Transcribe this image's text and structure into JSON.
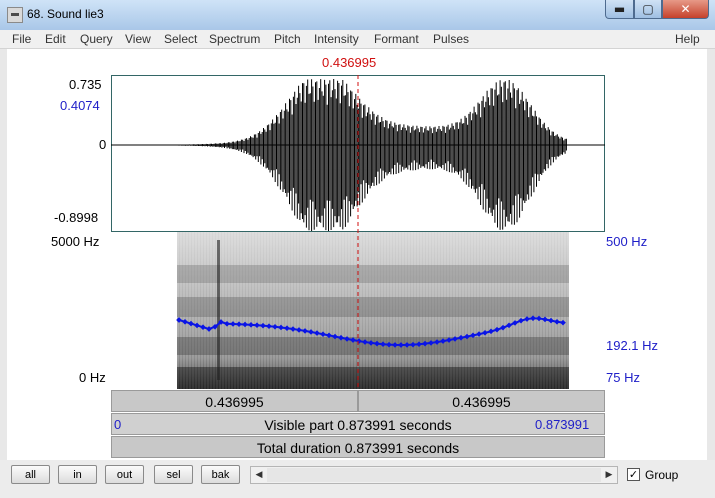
{
  "window": {
    "title": "68. Sound lie3",
    "min_glyph": "▬",
    "max_glyph": "▢",
    "close_glyph": "✕"
  },
  "menu": [
    "File",
    "Edit",
    "Query",
    "View",
    "Select",
    "Spectrum",
    "Pitch",
    "Intensity",
    "Formant",
    "Pulses",
    "Help"
  ],
  "cursor": {
    "time_label": "0.436995",
    "time_fraction": 0.5
  },
  "waveform": {
    "max_label": "0.735",
    "cursor_value_label": "0.4074",
    "zero_label": "0",
    "min_label": "-0.8998"
  },
  "spectrogram": {
    "top_label": "5000 Hz",
    "bottom_label": "0 Hz",
    "pitch_top_label": "500 Hz",
    "pitch_value_label": "192.1 Hz",
    "pitch_bottom_label": "75 Hz",
    "pitch_color": "#0a14e6"
  },
  "time_rows": {
    "left_segment": "0.436995",
    "right_segment": "0.436995",
    "visible_start": "0",
    "visible_text": "Visible part 0.873991 seconds",
    "visible_end": "0.873991",
    "total_text": "Total duration 0.873991 seconds"
  },
  "buttons": [
    "all",
    "in",
    "out",
    "sel",
    "bak"
  ],
  "group": {
    "label": "Group",
    "checked_glyph": "✓"
  }
}
